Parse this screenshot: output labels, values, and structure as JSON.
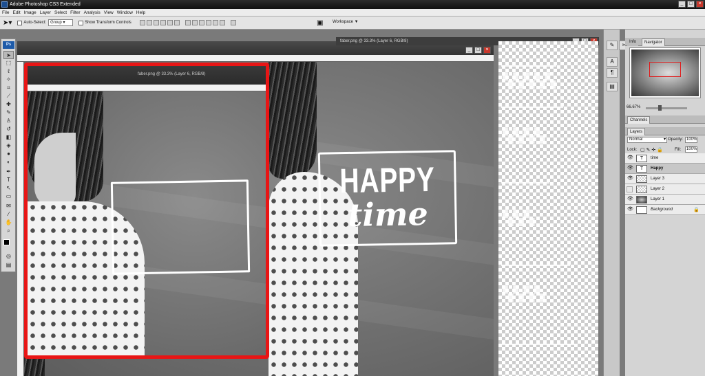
{
  "app": {
    "title": "Adobe Photoshop CS3 Extended"
  },
  "menu": [
    "File",
    "Edit",
    "Image",
    "Layer",
    "Select",
    "Filter",
    "Analysis",
    "View",
    "Window",
    "Help"
  ],
  "options_bar": {
    "auto_select_label": "Auto-Select:",
    "auto_select_value": "Group",
    "show_transform_label": "Show Transform Controls",
    "workspace_label": "Workspace ▼"
  },
  "documents": {
    "main_title": "faber.png @ 33.3% (Layer 6, RGB/8)",
    "inner_title": "faber.png @ 33.3% (Layer 6, RGB/8)",
    "third_title": "faber.png @ 33.3% (Layer 6, RGB/8)",
    "happy_text": "HAPPY",
    "time_text": "time"
  },
  "navigator": {
    "tabs": [
      "Info",
      "Navigator"
    ],
    "zoom": "66.67%"
  },
  "channels_tab": "Channels",
  "layers": {
    "tab": "Layers",
    "blend_mode": "Normal",
    "opacity_label": "Opacity:",
    "opacity_value": "100%",
    "lock_label": "Lock:",
    "fill_label": "Fill:",
    "fill_value": "100%",
    "items": [
      {
        "name": "time",
        "kind": "text",
        "visible": true
      },
      {
        "name": "Happy",
        "kind": "text",
        "visible": true,
        "selected": true
      },
      {
        "name": "Layer 3",
        "kind": "transparent",
        "visible": true
      },
      {
        "name": "Layer 2",
        "kind": "transparent",
        "visible": false
      },
      {
        "name": "Layer 1",
        "kind": "photo",
        "visible": true
      },
      {
        "name": "Background",
        "kind": "white",
        "visible": true,
        "locked": true
      }
    ]
  },
  "colors": {
    "highlight_border": "#e81515",
    "panel_bg": "#d4d4d4"
  }
}
